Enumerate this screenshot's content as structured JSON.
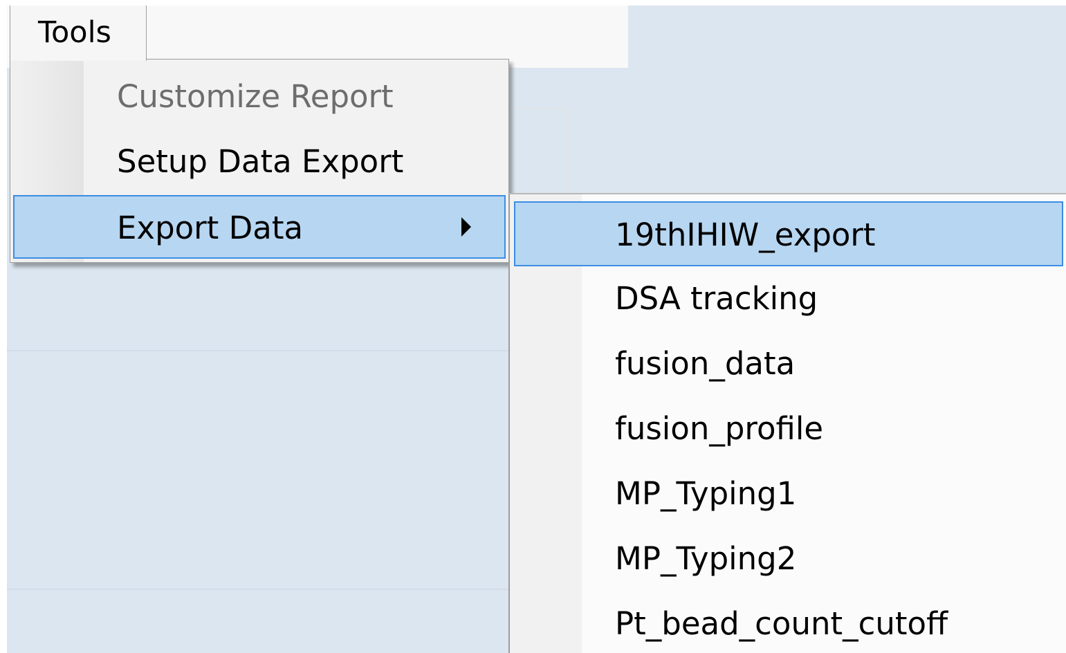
{
  "menubar": {
    "tools_label": "Tools"
  },
  "tools_menu": {
    "items": [
      {
        "label": "Customize Report",
        "enabled": false
      },
      {
        "label": "Setup Data Export",
        "enabled": true
      },
      {
        "label": "Export Data",
        "enabled": true,
        "highlighted": true,
        "has_submenu": true
      }
    ]
  },
  "export_submenu": {
    "items": [
      {
        "label": "19thIHIW_export",
        "highlighted": true
      },
      {
        "label": "DSA tracking"
      },
      {
        "label": "fusion_data"
      },
      {
        "label": "fusion_profile"
      },
      {
        "label": "MP_Typing1"
      },
      {
        "label": "MP_Typing2"
      },
      {
        "label": "Pt_bead_count_cutoff"
      }
    ]
  },
  "icons": {
    "submenu_arrow": "triangle-right-icon"
  },
  "colors": {
    "highlight_fill": "#b7d6f1",
    "highlight_border": "#3b8de4",
    "background_surface": "#dce6f0",
    "disabled_text": "#6d6d6d"
  }
}
